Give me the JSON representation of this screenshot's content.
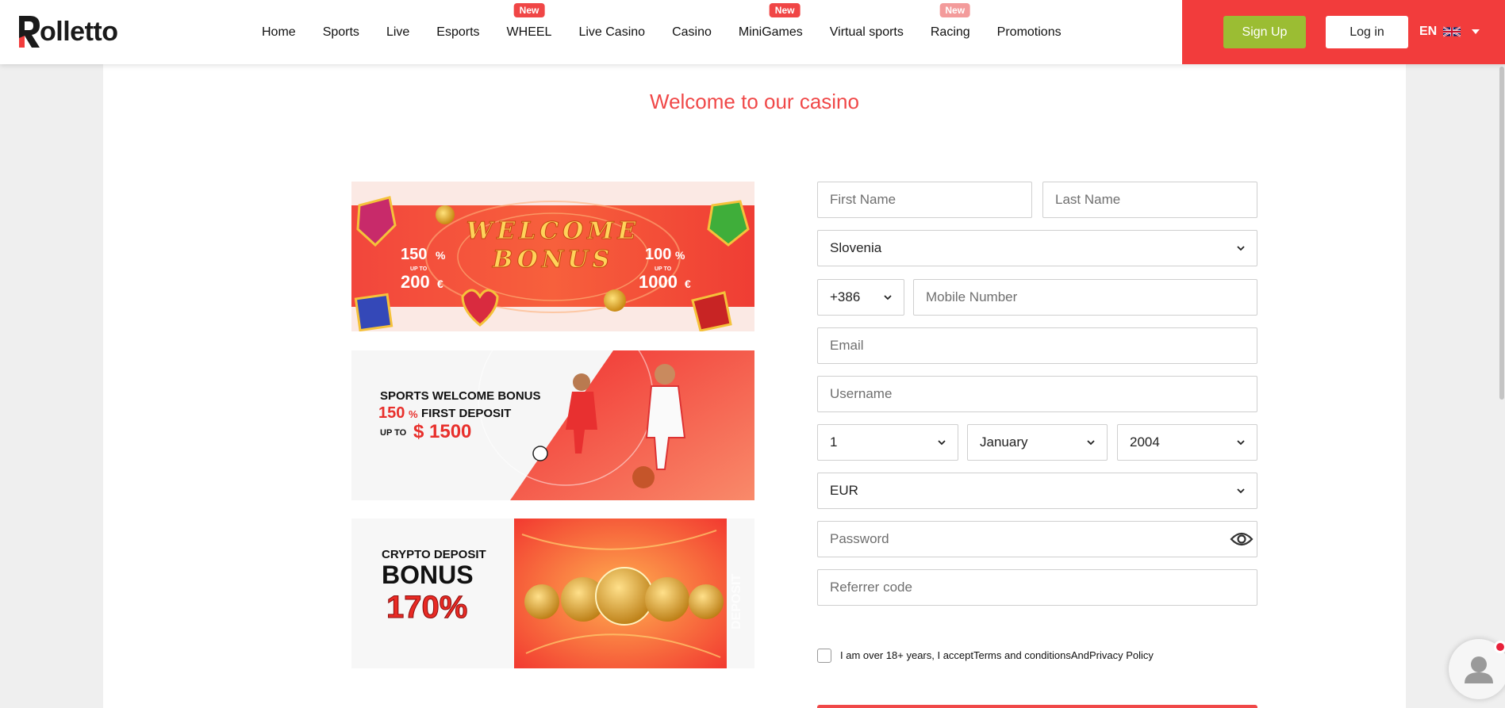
{
  "brand": {
    "name": "olletto",
    "logo_letter": "R",
    "accent": "#f23c3c",
    "text_color": "#1a1a1a"
  },
  "nav": {
    "items": [
      {
        "label": "Home",
        "badge": ""
      },
      {
        "label": "Sports",
        "badge": ""
      },
      {
        "label": "Live",
        "badge": ""
      },
      {
        "label": "Esports",
        "badge": ""
      },
      {
        "label": "WHEEL",
        "badge": "New"
      },
      {
        "label": "Live Casino",
        "badge": ""
      },
      {
        "label": "Casino",
        "badge": ""
      },
      {
        "label": "MiniGames",
        "badge": "New"
      },
      {
        "label": "Virtual sports",
        "badge": ""
      },
      {
        "label": "Racing",
        "badge": "New"
      },
      {
        "label": "Promotions",
        "badge": ""
      }
    ]
  },
  "auth": {
    "signup_label": "Sign Up",
    "login_label": "Log in",
    "language": "EN",
    "flag_icon": "uk-flag-icon",
    "signup_color": "#9bbd33"
  },
  "page": {
    "title": "Welcome to our casino"
  },
  "banners": {
    "welcome": {
      "title_line1": "WELCOME",
      "title_line2": "BONUS",
      "left_pct": "150",
      "left_pct_sign": "%",
      "left_upto": "UP TO",
      "left_amount": "200",
      "left_currency": "€",
      "right_pct": "100",
      "right_pct_sign": "%",
      "right_upto": "UP TO",
      "right_amount": "1000",
      "right_currency": "€"
    },
    "sports": {
      "line1": "SPORTS WELCOME BONUS",
      "pct": "150",
      "pct_sign": "%",
      "line2": "FIRST DEPOSIT",
      "upto": "UP TO",
      "amount": "$ 1500"
    },
    "crypto": {
      "line1": "CRYPTO DEPOSIT",
      "line2": "BONUS",
      "pct": "170%",
      "side_text": "DEPOSIT"
    }
  },
  "form": {
    "first_name": {
      "value": "",
      "placeholder": "First Name"
    },
    "last_name": {
      "value": "",
      "placeholder": "Last Name"
    },
    "country": "Slovenia",
    "phone_code": "+386",
    "mobile": {
      "value": "",
      "placeholder": "Mobile Number"
    },
    "email": {
      "value": "",
      "placeholder": "Email"
    },
    "username": {
      "value": "",
      "placeholder": "Username"
    },
    "birth_day": "1",
    "birth_month": "January",
    "birth_year": "2004",
    "currency": "EUR",
    "password": {
      "value": "",
      "placeholder": "Password"
    },
    "referrer": {
      "value": "",
      "placeholder": "Referrer code"
    },
    "terms_prefix": "I am over 18+ years, I accept",
    "terms_link": "Terms and conditions",
    "terms_and": "And",
    "privacy_link": "Privacy Policy"
  }
}
